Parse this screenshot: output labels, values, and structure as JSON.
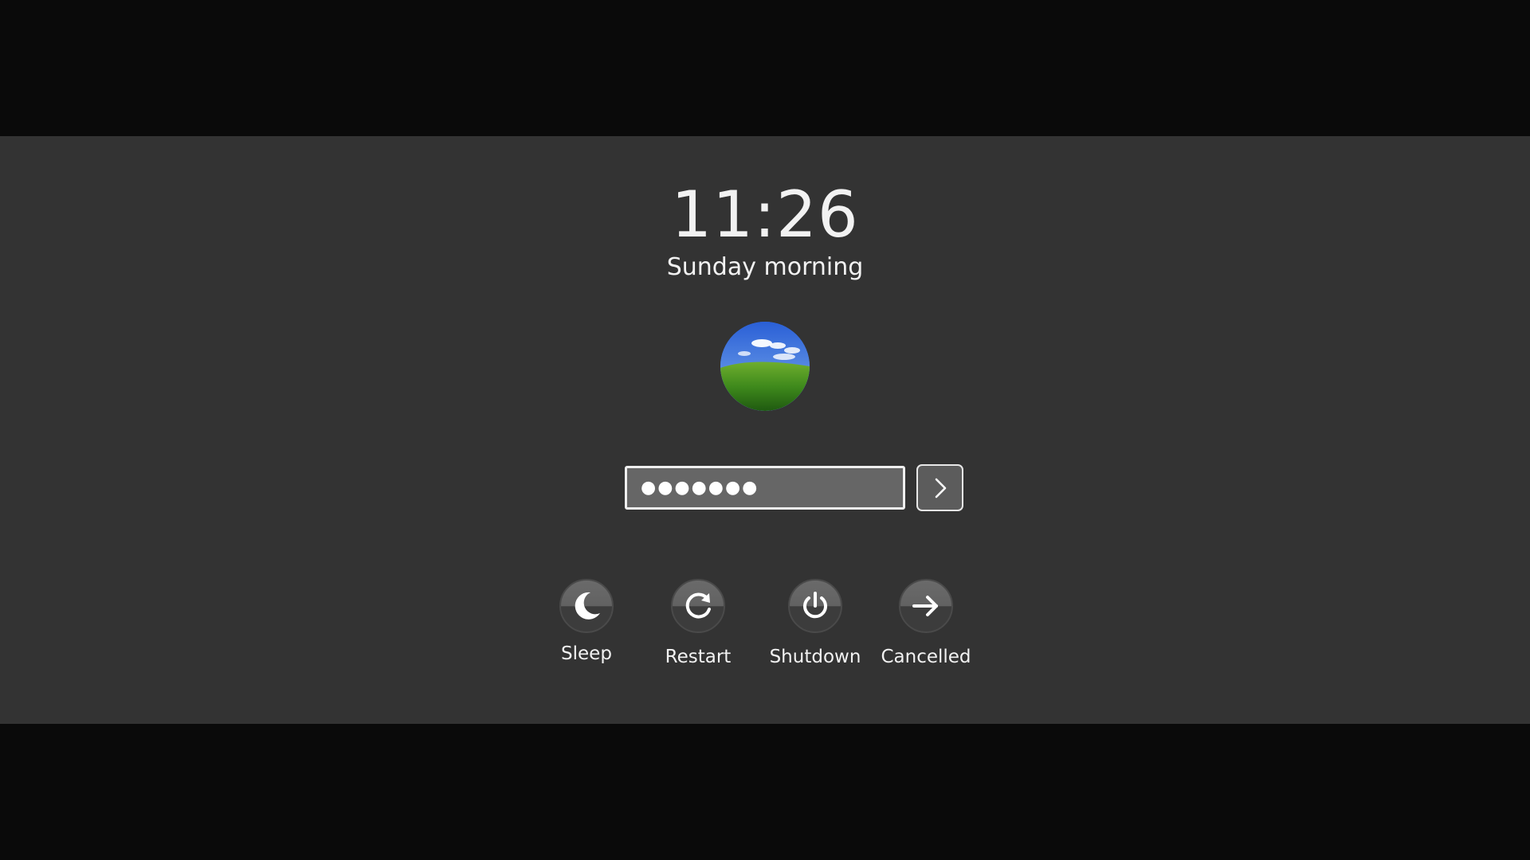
{
  "lock_screen": {
    "time": "11:26",
    "greeting": "Sunday morning",
    "avatar_icon": "rolling-green-hill-wallpaper",
    "password": {
      "masked_value": "●●●●●●●",
      "submit_icon": "chevron-right-icon"
    },
    "actions": [
      {
        "label": "Sleep",
        "icon": "moon-icon"
      },
      {
        "label": "Restart",
        "icon": "restart-icon"
      },
      {
        "label": "Shutdown",
        "icon": "power-icon"
      },
      {
        "label": "Cancelled",
        "icon": "arrow-right-icon"
      }
    ]
  },
  "colors": {
    "background": "#0a0a0a",
    "panel": "#333333",
    "input_fill": "#666666",
    "text": "#f2f2f2"
  }
}
